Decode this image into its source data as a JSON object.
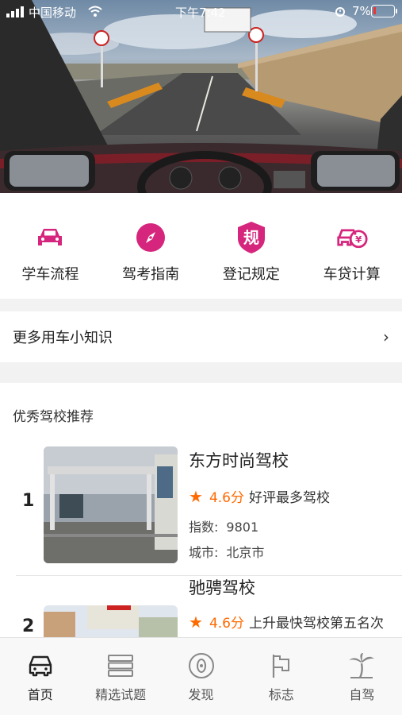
{
  "status_bar": {
    "carrier": "中国移动",
    "time": "下午7:42",
    "battery": "7%"
  },
  "colors": {
    "accent": "#d6257c",
    "rating": "#ff6a00"
  },
  "quick_links": [
    {
      "label": "学车流程",
      "icon": "car-icon"
    },
    {
      "label": "驾考指南",
      "icon": "compass-icon"
    },
    {
      "label": "登记规定",
      "icon": "rule-shield-icon",
      "glyph": "规"
    },
    {
      "label": "车贷计算",
      "icon": "car-loan-icon",
      "glyph": "¥"
    }
  ],
  "tips": {
    "label": "更多用车小知识",
    "chevron": "›"
  },
  "schools_section": {
    "title": "优秀驾校推荐",
    "items": [
      {
        "rank": "1",
        "name": "东方时尚驾校",
        "score": "4.6分",
        "tagline": "好评最多驾校",
        "index_label": "指数:",
        "index_value": "9801",
        "city_label": "城市:",
        "city_value": "北京市"
      },
      {
        "rank": "2",
        "name": "驰骋驾校",
        "score": "4.6分",
        "tagline": "上升最快驾校第五名次"
      }
    ]
  },
  "tabbar": [
    {
      "label": "首页",
      "icon": "car-front-icon",
      "active": true
    },
    {
      "label": "精选试题",
      "icon": "stack-icon",
      "active": false
    },
    {
      "label": "发现",
      "icon": "discover-icon",
      "active": false
    },
    {
      "label": "标志",
      "icon": "flag-icon",
      "active": false
    },
    {
      "label": "自驾",
      "icon": "palm-tree-icon",
      "active": false
    }
  ]
}
